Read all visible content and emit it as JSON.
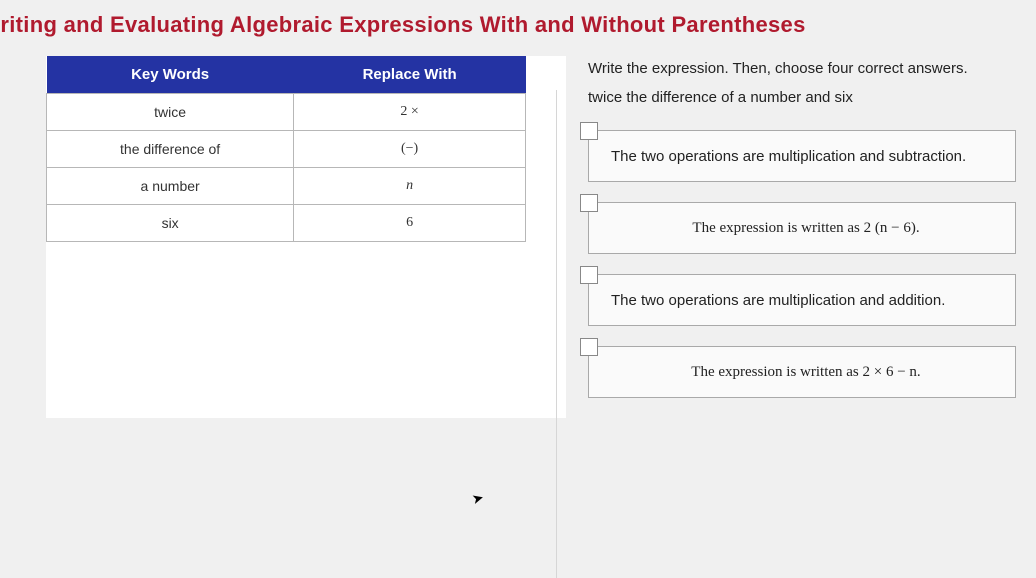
{
  "title": "Iriting and Evaluating Algebraic Expressions With and Without Parentheses",
  "table": {
    "header_left": "Key Words",
    "header_right": "Replace With",
    "rows": [
      {
        "key": "twice",
        "replace": "2 ×"
      },
      {
        "key": "the difference of",
        "replace": "(−)"
      },
      {
        "key": "a number",
        "replace": "n"
      },
      {
        "key": "six",
        "replace": "6"
      }
    ]
  },
  "instruction": "Write the expression. Then, choose four correct answers.",
  "prompt": "twice the difference of a number and six",
  "options": [
    {
      "text": "The two operations are multiplication and subtraction."
    },
    {
      "text": "The expression is written as 2 (n − 6)."
    },
    {
      "text": "The two operations are multiplication and addition."
    },
    {
      "text": "The expression is written as 2 × 6 − n."
    }
  ]
}
